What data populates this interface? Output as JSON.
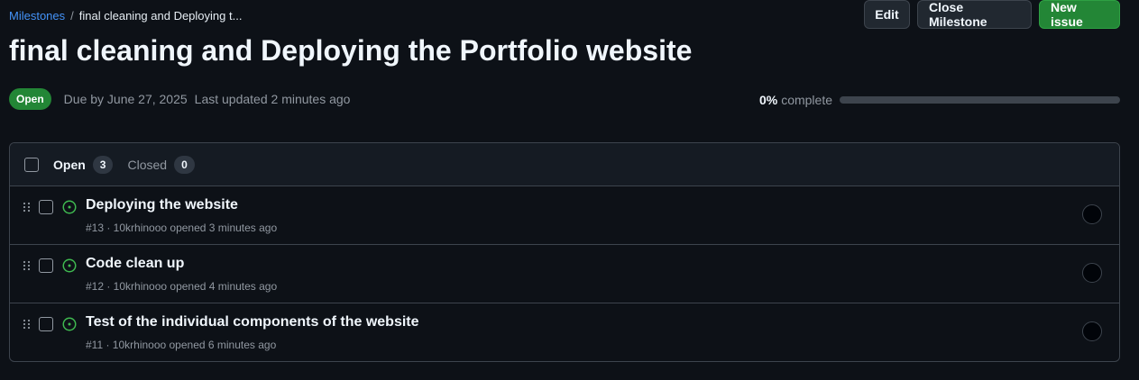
{
  "breadcrumb": {
    "parent": "Milestones",
    "separator": "/",
    "current": "final cleaning and Deploying t..."
  },
  "actions": {
    "edit_label": "Edit",
    "close_label": "Close Milestone",
    "new_issue_label": "New issue"
  },
  "milestone": {
    "title": "final cleaning and Deploying the Portfolio website",
    "state": "Open",
    "due": "Due by June 27, 2025",
    "updated": "Last updated 2 minutes ago",
    "progress_percent_text": "0%",
    "progress_complete_text": "complete",
    "progress_fraction": 0
  },
  "issues_header": {
    "open_label": "Open",
    "open_count": "3",
    "closed_label": "Closed",
    "closed_count": "0"
  },
  "issues": [
    {
      "title": "Deploying the website",
      "meta": "#13 · 10krhinooo opened 3 minutes ago"
    },
    {
      "title": "Code clean up",
      "meta": "#12 · 10krhinooo opened 4 minutes ago"
    },
    {
      "title": "Test of the individual components of the website",
      "meta": "#11 · 10krhinooo opened 6 minutes ago"
    }
  ],
  "colors": {
    "background": "#0d1117",
    "accent_green": "#238636",
    "link_blue": "#4493f8",
    "open_icon_green": "#3fb950"
  },
  "icons": {
    "issue_state": "issue-opened-icon",
    "drag": "grabber-icon"
  }
}
